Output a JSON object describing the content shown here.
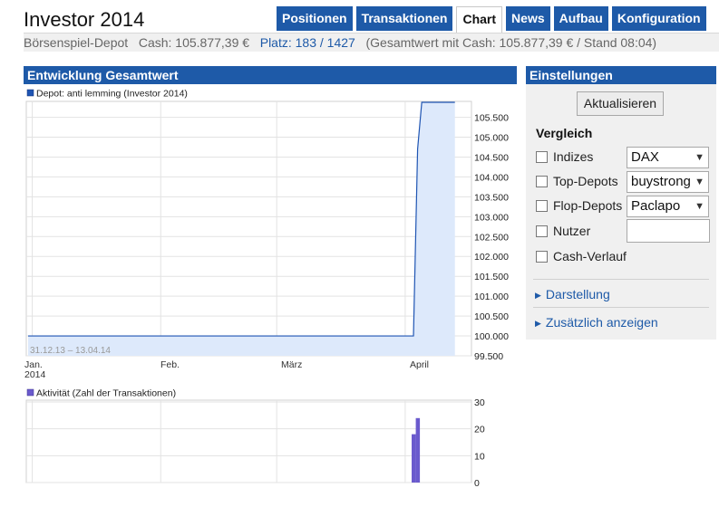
{
  "header": {
    "title": "Investor 2014",
    "tabs": [
      {
        "label": "Positionen",
        "active": false
      },
      {
        "label": "Transaktionen",
        "active": false
      },
      {
        "label": "Chart",
        "active": true
      },
      {
        "label": "News",
        "active": false
      },
      {
        "label": "Aufbau",
        "active": false
      },
      {
        "label": "Konfiguration",
        "active": false
      }
    ]
  },
  "infobar": {
    "depot": "Börsenspiel-Depot",
    "cash": "Cash: 105.877,39 €",
    "platz_link": "Platz:",
    "platz_value": "183 / 1427",
    "gesamtwert": "(Gesamtwert mit Cash: 105.877,39 € / Stand 08:04)"
  },
  "main": {
    "section_title": "Entwicklung Gesamtwert"
  },
  "colors": {
    "accent": "#1e5aa8",
    "line": "#1f55b3",
    "area_fill": "#dde9fb",
    "activity_bar": "#6a5acd"
  },
  "chart_data": [
    {
      "type": "area",
      "legend": "Depot: anti lemming (Investor 2014)",
      "annotation": "31.12.13 – 13.04.14",
      "x_ticks": [
        "Jan.\n2014",
        "Feb.",
        "März",
        "April"
      ],
      "y_ticks": [
        "99.500",
        "100.000",
        "100.500",
        "101.000",
        "101.500",
        "102.000",
        "102.500",
        "103.000",
        "103.500",
        "104.000",
        "104.500",
        "105.000",
        "105.500"
      ],
      "ylim": [
        99500,
        105900
      ],
      "grid": true,
      "x": [
        "2013-12-31",
        "2014-04-02",
        "2014-04-03",
        "2014-04-04",
        "2014-04-05",
        "2014-04-13"
      ],
      "values": [
        100000,
        100000,
        100000,
        104700,
        105877,
        105877
      ]
    },
    {
      "type": "bar",
      "legend": "Aktivität (Zahl der Transaktionen)",
      "y_ticks": [
        "0",
        "10",
        "20",
        "30"
      ],
      "ylim": [
        0,
        30
      ],
      "grid": true,
      "x": [
        "2014-04-03",
        "2014-04-04"
      ],
      "values": [
        18,
        24
      ]
    }
  ],
  "settings": {
    "title": "Einstellungen",
    "update_button": "Aktualisieren",
    "compare_title": "Vergleich",
    "rows": [
      {
        "label": "Indizes",
        "select": "DAX"
      },
      {
        "label": "Top-Depots",
        "select": "buystrong"
      },
      {
        "label": "Flop-Depots",
        "select": "Paclapo"
      },
      {
        "label": "Nutzer",
        "input_value": ""
      },
      {
        "label": "Cash-Verlauf"
      }
    ],
    "expanders": [
      "Darstellung",
      "Zusätzlich anzeigen"
    ]
  }
}
